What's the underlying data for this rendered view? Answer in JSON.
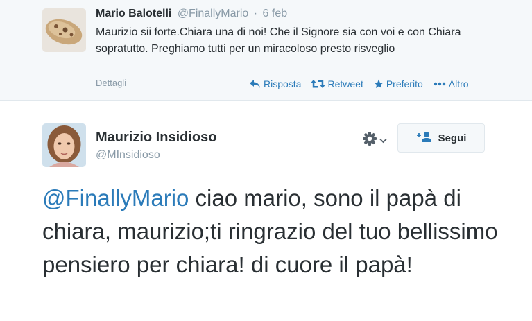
{
  "parent_tweet": {
    "author_name": "Mario Balotelli",
    "author_handle": "@FinallyMario",
    "separator": "·",
    "date": "6 feb",
    "text": "Maurizio sii forte.Chiara una di noi! Che il Signore sia con voi e con Chiara sopratutto. Preghiamo tutti per un miracoloso presto risveglio",
    "details_label": "Dettagli",
    "actions": {
      "reply": "Risposta",
      "retweet": "Retweet",
      "favorite": "Preferito",
      "more": "Altro"
    }
  },
  "main_tweet": {
    "author_name": "Maurizio Insidioso",
    "author_handle": "@MInsidioso",
    "follow_label": "Segui",
    "mention": "@FinallyMario",
    "text": " ciao mario, sono il papà di chiara, maurizio;ti ringrazio del tuo bellissimo pensiero per chiara! di cuore il papà!"
  },
  "colors": {
    "link_blue": "#2b7bb9",
    "muted_gray": "#8899a6",
    "text_dark": "#292f33",
    "parent_bg": "#f5f8fa"
  },
  "icons": {
    "reply": "reply-arrow-icon",
    "retweet": "retweet-icon",
    "favorite": "star-icon",
    "more": "ellipsis-icon",
    "settings": "gear-icon",
    "follow": "add-user-icon"
  }
}
